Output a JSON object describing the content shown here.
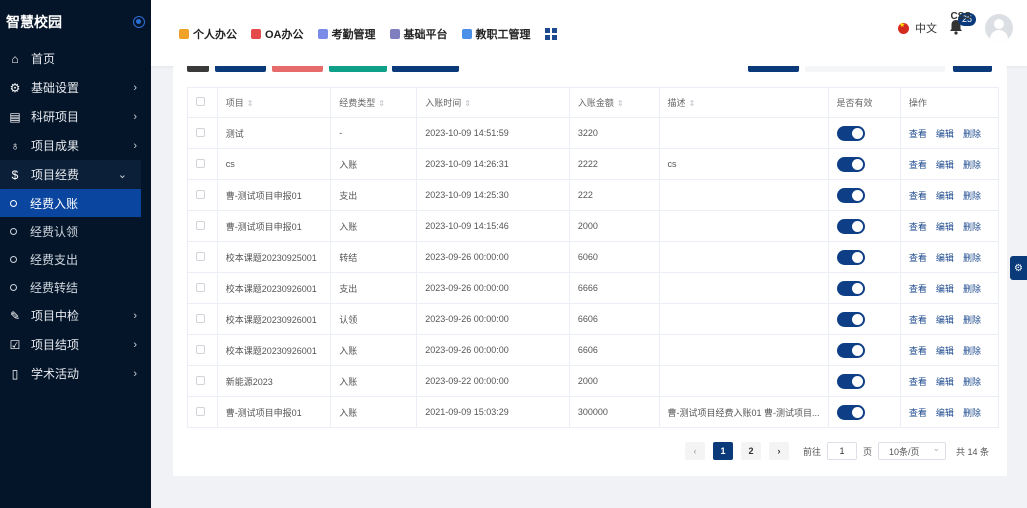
{
  "app": {
    "title": "智慧校园"
  },
  "sidebar": {
    "items": [
      {
        "label": "首页",
        "icon": "home-icon",
        "arrow": false
      },
      {
        "label": "基础设置",
        "icon": "gear-icon",
        "arrow": true
      },
      {
        "label": "科研项目",
        "icon": "document-icon",
        "arrow": true
      },
      {
        "label": "项目成果",
        "icon": "award-icon",
        "arrow": true
      },
      {
        "label": "项目经费",
        "icon": "dollar-icon",
        "arrow": true,
        "open": true
      }
    ],
    "sub_items": [
      {
        "label": "经费入账",
        "active": true
      },
      {
        "label": "经费认领"
      },
      {
        "label": "经费支出"
      },
      {
        "label": "经费转结"
      }
    ],
    "items_after": [
      {
        "label": "项目中检",
        "icon": "pen-icon"
      },
      {
        "label": "项目结项",
        "icon": "check-icon"
      },
      {
        "label": "学术活动",
        "icon": "book-icon"
      }
    ]
  },
  "topnav": [
    {
      "label": "个人办公",
      "color": "#f0a22a"
    },
    {
      "label": "OA办公",
      "color": "#e64b4b"
    },
    {
      "label": "考勤管理",
      "color": "#7b8be8"
    },
    {
      "label": "基础平台",
      "color": "#7f7fbf"
    },
    {
      "label": "教职工管理",
      "color": "#4a8fe8"
    }
  ],
  "header": {
    "lang": "中文",
    "badge": "25",
    "user": "CSS"
  },
  "toolbar_colors": [
    "#3a3a3a",
    "#0b3a7a",
    "#e86b6b",
    "#0fa08a",
    "#0b3a7a",
    "#0b3a7a",
    "#0b3a7a"
  ],
  "table": {
    "headers": [
      "项目",
      "经费类型",
      "入账时间",
      "入账金额",
      "描述",
      "是否有效",
      "操作"
    ],
    "ops": [
      "查看",
      "编辑",
      "删除"
    ],
    "rows": [
      [
        "测试",
        "-",
        "2023-10-09 14:51:59",
        "3220",
        ""
      ],
      [
        "cs",
        "入账",
        "2023-10-09 14:26:31",
        "2222",
        "cs"
      ],
      [
        "曹-测试项目申报01",
        "支出",
        "2023-10-09 14:25:30",
        "222",
        ""
      ],
      [
        "曹-测试项目申报01",
        "入账",
        "2023-10-09 14:15:46",
        "2000",
        ""
      ],
      [
        "校本课题20230925001",
        "转结",
        "2023-09-26 00:00:00",
        "6060",
        ""
      ],
      [
        "校本课题20230926001",
        "支出",
        "2023-09-26 00:00:00",
        "6666",
        ""
      ],
      [
        "校本课题20230926001",
        "认领",
        "2023-09-26 00:00:00",
        "6606",
        ""
      ],
      [
        "校本课题20230926001",
        "入账",
        "2023-09-26 00:00:00",
        "6606",
        ""
      ],
      [
        "新能源2023",
        "入账",
        "2023-09-22 00:00:00",
        "2000",
        ""
      ],
      [
        "曹-测试项目申报01",
        "入账",
        "2021-09-09 15:03:29",
        "300000",
        "曹-测试项目经费入账01 曹-测试项目..."
      ]
    ]
  },
  "pager": {
    "pages": [
      "1",
      "2"
    ],
    "goto_label": "前往",
    "goto_value": "1",
    "page_unit": "页",
    "size": "10条/页",
    "total": "共 14 条"
  }
}
